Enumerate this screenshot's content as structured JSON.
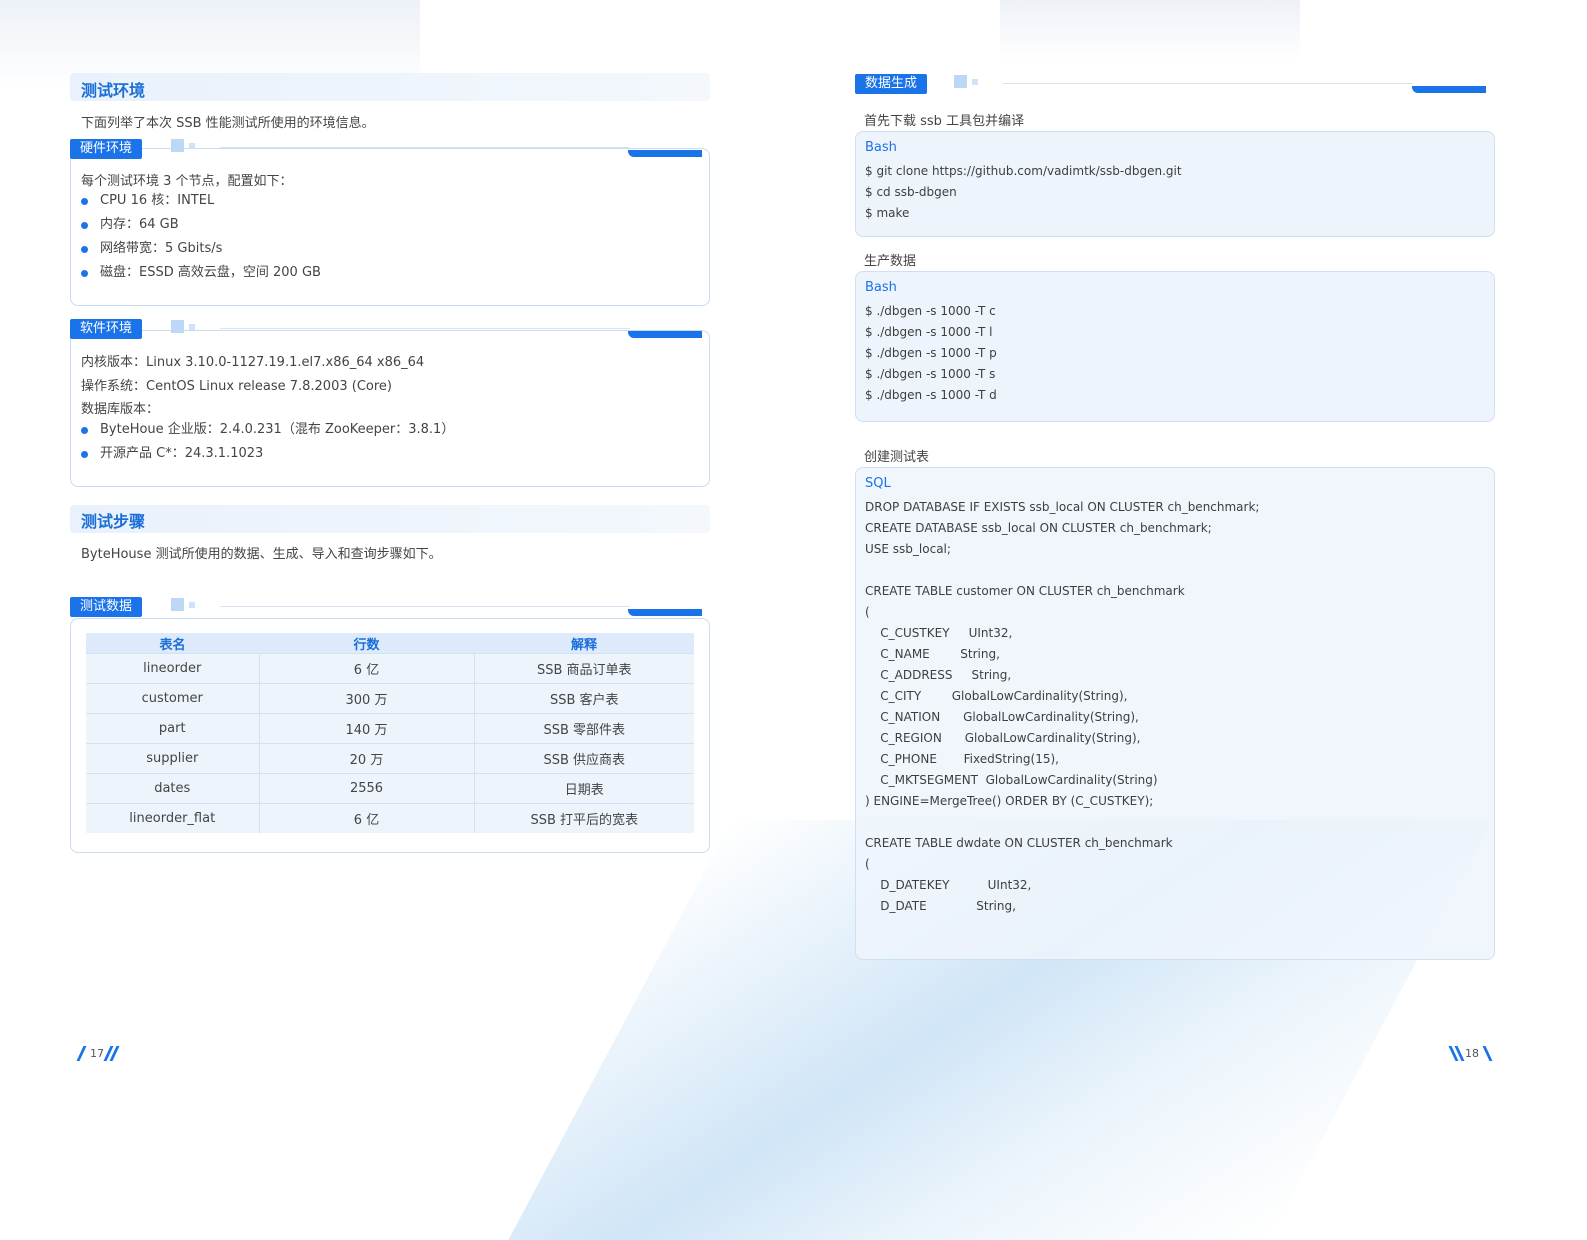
{
  "left": {
    "env_title": "测试环境",
    "env_intro": "下面列举了本次 SSB 性能测试所使用的环境信息。",
    "hardware": {
      "tag": "硬件环境",
      "intro": "每个测试环境 3 个节点，配置如下：",
      "items": [
        "CPU 16 核：INTEL",
        "内存：64 GB",
        "网络带宽：5 Gbits/s",
        "磁盘：ESSD 高效云盘，空间 200 GB"
      ]
    },
    "software": {
      "tag": "软件环境",
      "lines": [
        "内核版本：Linux 3.10.0-1127.19.1.el7.x86_64 x86_64",
        "操作系统：CentOS Linux release 7.8.2003 (Core)",
        "数据库版本："
      ],
      "items": [
        "ByteHoue 企业版：2.4.0.231（混布 ZooKeeper：3.8.1）",
        "开源产品 C*：24.3.1.1023"
      ]
    },
    "steps_title": "测试步骤",
    "steps_intro": "ByteHouse 测试所使用的数据、生成、导入和查询步骤如下。",
    "test_data": {
      "tag": "测试数据",
      "headers": [
        "表名",
        "行数",
        "解释"
      ],
      "rows": [
        [
          "lineorder",
          "6 亿",
          "SSB 商品订单表"
        ],
        [
          "customer",
          "300 万",
          "SSB 客户表"
        ],
        [
          "part",
          "140 万",
          "SSB 零部件表"
        ],
        [
          "supplier",
          "20 万",
          "SSB 供应商表"
        ],
        [
          "dates",
          "2556",
          "日期表"
        ],
        [
          "lineorder_flat",
          "6 亿",
          "SSB 打平后的宽表"
        ]
      ]
    },
    "page_number": "17"
  },
  "right": {
    "tag": "数据生成",
    "download_label": "首先下载  ssb 工具包并编译",
    "code1": {
      "lang": "Bash",
      "text": "$ git clone https://github.com/vadimtk/ssb-dbgen.git\n$ cd ssb-dbgen\n$ make"
    },
    "produce_label": "生产数据",
    "code2": {
      "lang": "Bash",
      "text": "$ ./dbgen -s 1000 -T c\n$ ./dbgen -s 1000 -T l\n$ ./dbgen -s 1000 -T p\n$ ./dbgen -s 1000 -T s\n$ ./dbgen -s 1000 -T d"
    },
    "create_label": "创建测试表",
    "code3": {
      "lang": "SQL",
      "text": "DROP DATABASE IF EXISTS ssb_local ON CLUSTER ch_benchmark;\nCREATE DATABASE ssb_local ON CLUSTER ch_benchmark;\nUSE ssb_local;\n\nCREATE TABLE customer ON CLUSTER ch_benchmark\n(\n    C_CUSTKEY     UInt32,\n    C_NAME        String,\n    C_ADDRESS     String,\n    C_CITY        GlobalLowCardinality(String),\n    C_NATION      GlobalLowCardinality(String),\n    C_REGION      GlobalLowCardinality(String),\n    C_PHONE       FixedString(15),\n    C_MKTSEGMENT  GlobalLowCardinality(String)\n) ENGINE=MergeTree() ORDER BY (C_CUSTKEY);\n\nCREATE TABLE dwdate ON CLUSTER ch_benchmark\n(\n    D_DATEKEY          UInt32,\n    D_DATE             String,"
    },
    "page_number": "18"
  },
  "colors": {
    "accent": "#1a73e8",
    "title": "#1b6fd8",
    "code_bg": "#eef4fc",
    "border": "#c9dcf2"
  }
}
